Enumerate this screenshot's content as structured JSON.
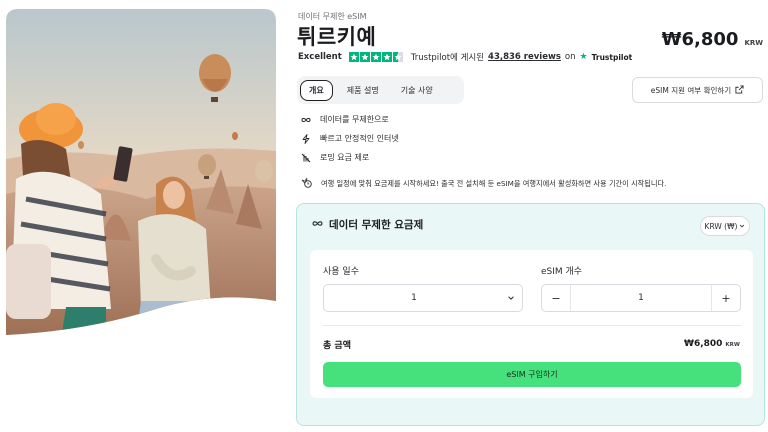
{
  "product": {
    "eyebrow": "데이터 무제한 eSIM",
    "title": "튀르키예",
    "price": "₩6,800",
    "price_currency": "KRW"
  },
  "rating": {
    "label": "Excellent",
    "stars": 4.5,
    "posted_on": "Trustpilot에 게시된",
    "reviews": "43,836 reviews",
    "on": "on",
    "brand": "Trustpilot"
  },
  "tabs": [
    {
      "label": "개요",
      "active": true
    },
    {
      "label": "제품 설명",
      "active": false
    },
    {
      "label": "기술 사양",
      "active": false
    }
  ],
  "check_button": {
    "label": "eSIM 지원 여부 확인하기",
    "icon": "external-link-icon"
  },
  "features": [
    {
      "icon": "infinity-icon",
      "text": "데이터를 무제한으로"
    },
    {
      "icon": "lightning-icon",
      "text": "빠르고 안정적인 인터넷"
    },
    {
      "icon": "no-roaming-icon",
      "text": "로밍 요금 제로"
    }
  ],
  "note": {
    "icon": "airplane-clock-icon",
    "text": "여행 일정에 맞춰 요금제를 시작하세요! 출국 전 설치해 둔 eSIM을 여행지에서 활성화하면 사용 기간이 시작됩니다."
  },
  "plan": {
    "title": "데이터 무제한 요금제",
    "currency_select": "KRW (₩)",
    "days_label": "사용 일수",
    "days_value": "1",
    "count_label": "eSIM 개수",
    "count_value": "1",
    "minus": "−",
    "plus": "+",
    "total_label": "총 금액",
    "total_value": "₩6,800",
    "total_currency": "KRW",
    "buy_label": "eSIM 구입하기"
  },
  "colors": {
    "accent_green": "#46e07c",
    "trustpilot_green": "#00b67a",
    "card_bg": "#eaf7f7"
  }
}
